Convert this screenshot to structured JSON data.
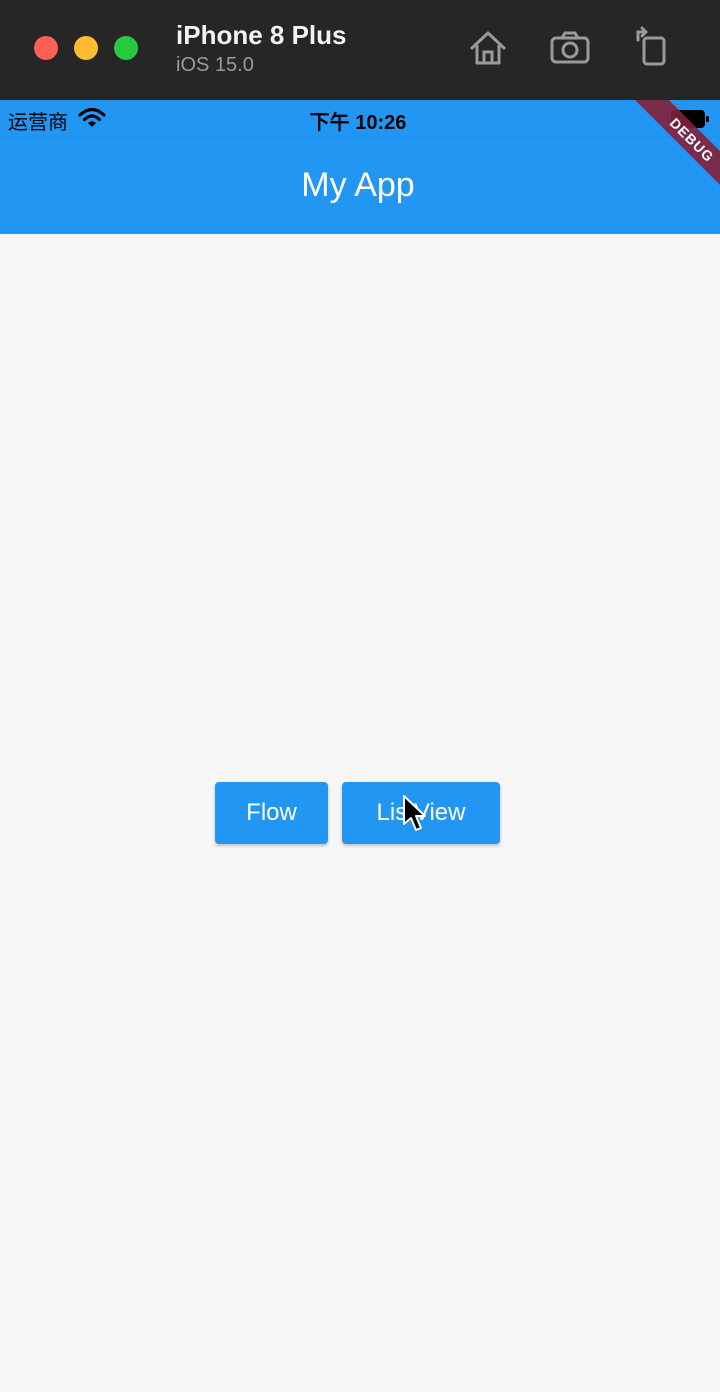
{
  "simulator": {
    "device_name": "iPhone 8 Plus",
    "os_version": "iOS 15.0",
    "toolbar_icons": [
      "home-icon",
      "screenshot-camera-icon",
      "rotate-icon"
    ]
  },
  "status_bar": {
    "carrier": "运营商",
    "time": "下午 10:26"
  },
  "app_bar": {
    "title": "My App",
    "color": "#2196f3"
  },
  "debug_banner": {
    "label": "DEBUG"
  },
  "buttons": [
    {
      "label": "Flow"
    },
    {
      "label": "ListView"
    }
  ]
}
